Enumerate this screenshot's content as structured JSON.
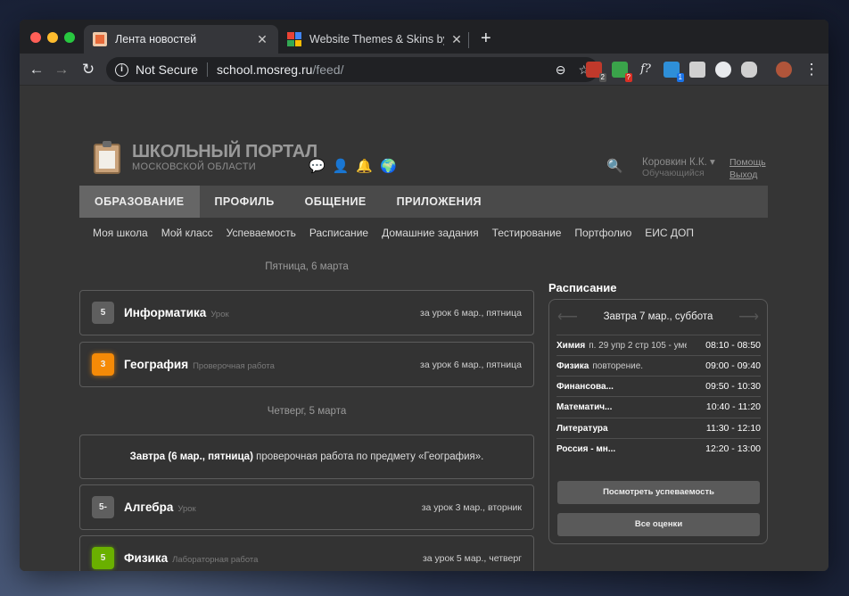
{
  "browser": {
    "tabs": [
      {
        "title": "Лента новостей",
        "active": true
      },
      {
        "title": "Website Themes & Skins by St",
        "active": false
      }
    ],
    "url": {
      "security": "Not Secure",
      "domain": "school.mosreg.ru",
      "path": "/feed/"
    },
    "extensions": [
      {
        "name": "abp-icon",
        "badge": "2",
        "color": "#c0392b"
      },
      {
        "name": "download-icon",
        "badge": "?",
        "color": "#3aa34a"
      },
      {
        "name": "function-icon",
        "badge": "",
        "color": "#35363a"
      },
      {
        "name": "s-icon",
        "badge": "1",
        "color": "#2e8fd8"
      },
      {
        "name": "printer-icon",
        "badge": "",
        "color": "#d0d0d0"
      },
      {
        "name": "gauge-icon",
        "badge": "",
        "color": "#e8eaed"
      },
      {
        "name": "database-icon",
        "badge": "",
        "color": "#d0d0d0"
      },
      {
        "name": "avatar-icon",
        "badge": "",
        "color": "#b0553a"
      }
    ]
  },
  "site": {
    "logo_title": "ШКОЛЬНЫЙ ПОРТАЛ",
    "logo_subtitle": "МОСКОВСКОЙ ОБЛАСТИ",
    "user_name": "Коровкин К.К. ▾",
    "user_role": "Обучающийся",
    "help": "Помощь",
    "logout": "Выход"
  },
  "main_nav": [
    "ОБРАЗОВАНИЕ",
    "ПРОФИЛЬ",
    "ОБЩЕНИЕ",
    "ПРИЛОЖЕНИЯ"
  ],
  "sub_nav": [
    "Моя школа",
    "Мой класс",
    "Успеваемость",
    "Расписание",
    "Домашние задания",
    "Тестирование",
    "Портфолио",
    "ЕИС ДОП"
  ],
  "feed": {
    "date1": "Пятница, 6 марта",
    "date2": "Четверг, 5 марта",
    "items": [
      {
        "grade": "5",
        "subject": "Информатика",
        "kind": "Урок",
        "when": "за урок 6 мар., пятница"
      },
      {
        "grade": "3",
        "subject": "География",
        "kind": "Проверочная работа",
        "when": "за урок 6 мар., пятница"
      },
      {
        "grade": "5-",
        "subject": "Алгебра",
        "kind": "Урок",
        "when": "за урок 3 мар., вторник"
      },
      {
        "grade": "5",
        "subject": "Физика",
        "kind": "Лабораторная работа",
        "when": "за урок 5 мар., четверг"
      }
    ],
    "notice_bold": "Завтра (6 мар., пятница)",
    "notice_text": " проверочная работа по предмету «География»."
  },
  "schedule": {
    "title": "Расписание",
    "day": "Завтра 7 мар., суббота",
    "lessons": [
      {
        "subject": "Химия",
        "topic": "п. 29 упр 2 стр 105 - умет...",
        "time": "08:10 - 08:50"
      },
      {
        "subject": "Физика",
        "topic": "повторение.",
        "time": "09:00 - 09:40"
      },
      {
        "subject": "Финансова...",
        "topic": "",
        "time": "09:50 - 10:30"
      },
      {
        "subject": "Математич...",
        "topic": "",
        "time": "10:40 - 11:20"
      },
      {
        "subject": "Литература",
        "topic": "",
        "time": "11:30 - 12:10"
      },
      {
        "subject": "Россия - мн...",
        "topic": "",
        "time": "12:20 - 13:00"
      }
    ],
    "btn_grades": "Посмотреть успеваемость",
    "btn_all": "Все оценки"
  }
}
